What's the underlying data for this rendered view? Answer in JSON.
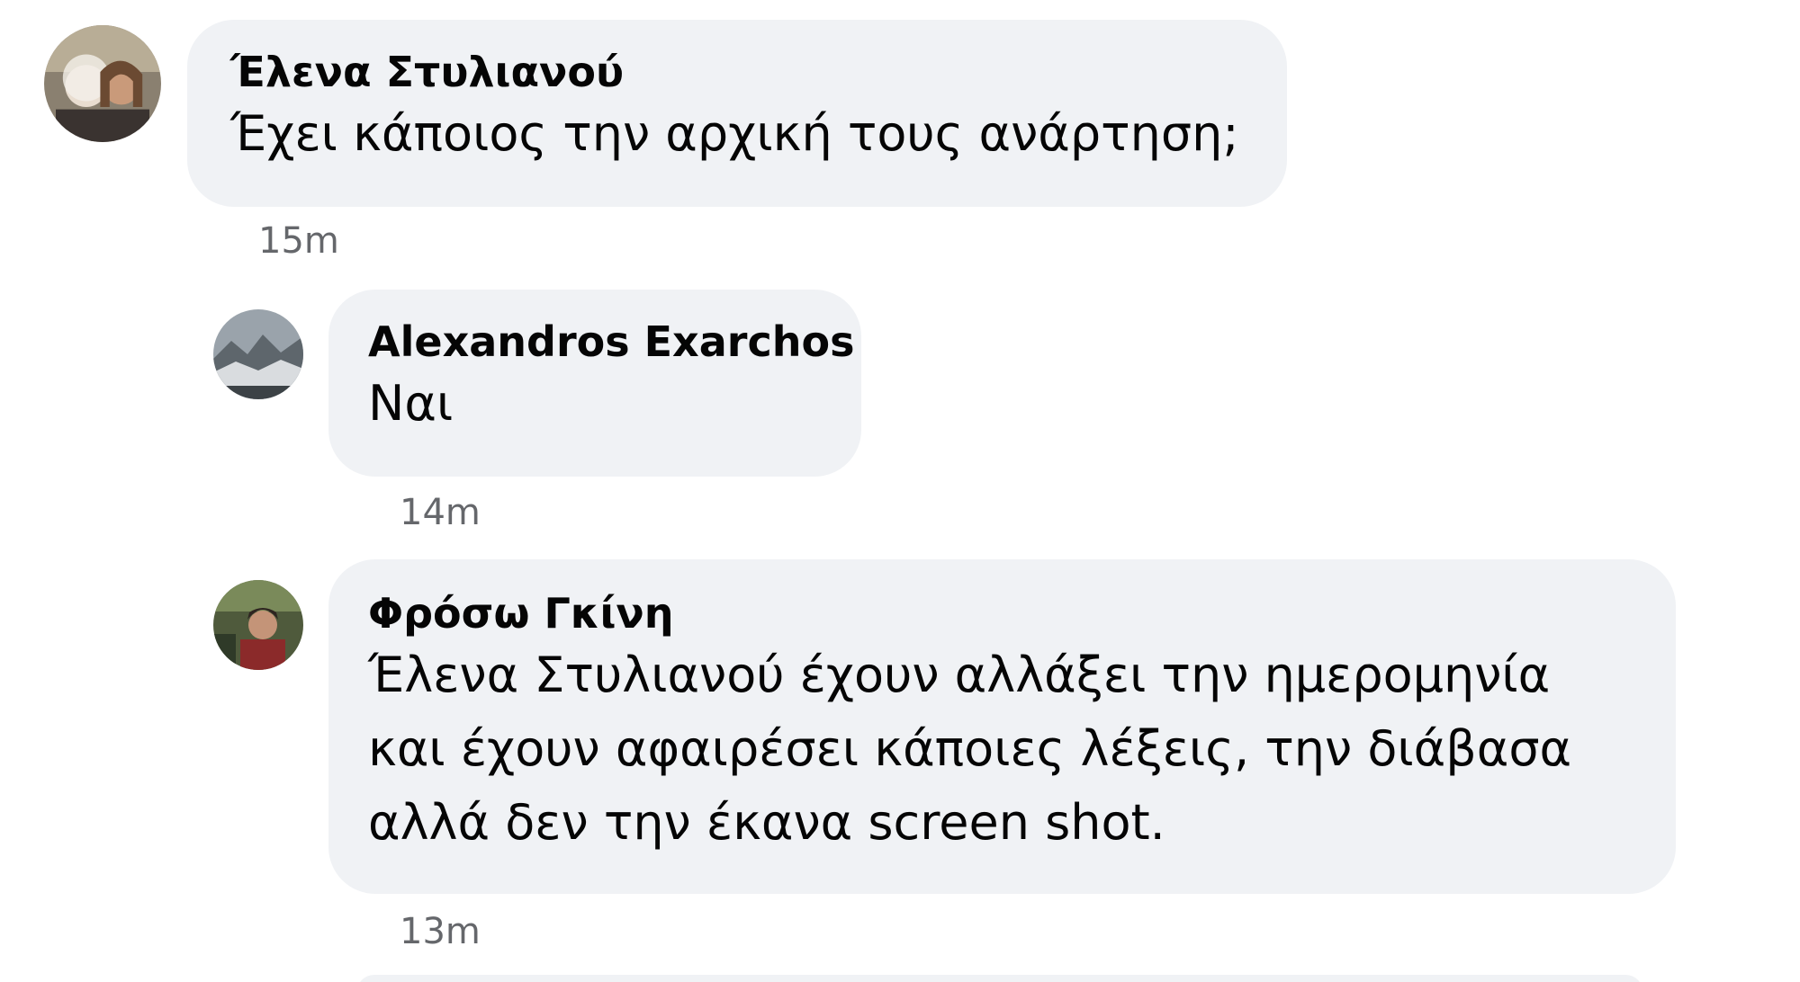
{
  "comments": [
    {
      "author": "Έλενα Στυλιανού",
      "text": "Έχει κάποιος την αρχική τους ανάρτηση;",
      "time": "15m"
    },
    {
      "author": "Alexandros Exarchos",
      "text": "Ναι",
      "time": "14m"
    },
    {
      "author": "Φρόσω Γκίνη",
      "text_lines": [
        "Έλενα Στυλιανού έχουν αλλάξει την ημερομηνία",
        "και έχουν αφαιρέσει κάποιες λέξεις, την διάβασα",
        "αλλά δεν την έκανα screen shot."
      ],
      "time": "13m"
    }
  ],
  "colors": {
    "bubble": "#f0f2f5",
    "text": "#050505",
    "timestamp": "#65676b"
  }
}
